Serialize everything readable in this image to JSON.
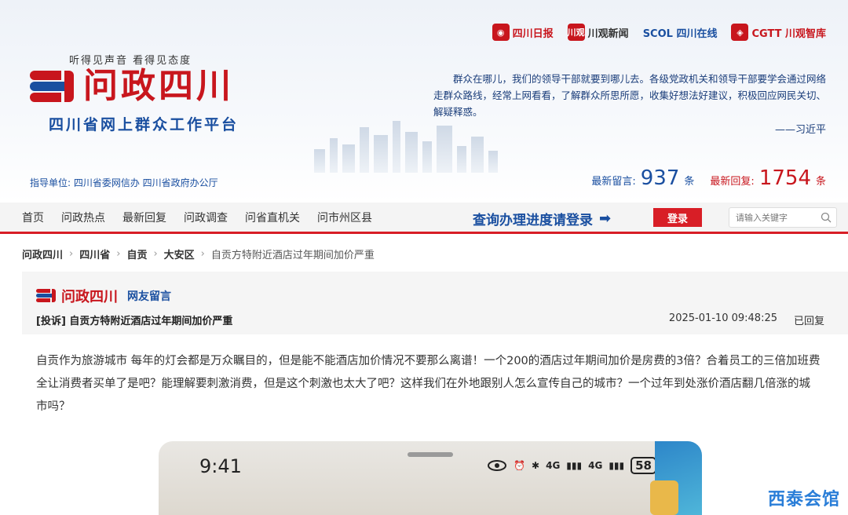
{
  "colors": {
    "brand_red": "#c8161d",
    "brand_blue": "#1a4fa0",
    "nav_red": "#d81e26"
  },
  "partners": [
    {
      "name": "四川日报",
      "icon": "sichuan-daily-logo"
    },
    {
      "name": "川观新闻",
      "mark": "川观",
      "icon": "chuanguan-logo"
    },
    {
      "name": "SCOL 四川在线",
      "icon": "scol-logo"
    },
    {
      "name": "CGTT 川观智库",
      "icon": "cgtt-logo"
    }
  ],
  "header": {
    "slogan": "听得见声音  看得见态度",
    "title": "问政四川",
    "subtitle": "四川省网上群众工作平台",
    "guidance": "指导单位: 四川省委网信办 四川省政府办公厅",
    "quote": "群众在哪儿，我们的领导干部就要到哪儿去。各级党政机关和领导干部要学会通过网络走群众路线，经常上网看看，了解群众所思所愿，收集好想法好建议，积极回应网民关切、解疑释惑。",
    "quote_author": "——习近平",
    "stats": {
      "latest_message_label": "最新留言:",
      "latest_message_count": "937",
      "latest_message_unit": "条",
      "latest_reply_label": "最新回复:",
      "latest_reply_count": "1754",
      "latest_reply_unit": "条"
    }
  },
  "nav": {
    "items": [
      "首页",
      "问政热点",
      "最新回复",
      "问政调查",
      "问省直机关",
      "问市州区县"
    ],
    "cta": "查询办理进度请登录",
    "login_label": "登录",
    "search_placeholder": "请输入关键字"
  },
  "breadcrumb": {
    "items": [
      "问政四川",
      "四川省",
      "自贡",
      "大安区"
    ],
    "current": "自贡方特附近酒店过年期间加价严重"
  },
  "post": {
    "logo_text": "问政四川",
    "type_label": "网友留言",
    "title": "[投诉] 自贡方特附近酒店过年期间加价严重",
    "date": "2025-01-10 09:48:25",
    "status": "已回复",
    "body": "自贡作为旅游城市 每年的灯会都是万众瞩目的，但是能不能酒店加价情况不要那么离谱！一个200的酒店过年期间加价是房费的3倍？合着员工的三倍加班费全让消费者买单了是吧？能理解要刺激消费，但是这个刺激也太大了吧？这样我们在外地跟别人怎么宣传自己的城市？一个过年到处涨价酒店翻几倍涨的城市吗？"
  },
  "phone": {
    "time": "9:41",
    "signal1": "4G",
    "signal2": "4G",
    "battery": "58"
  },
  "watermark": "西泰会馆"
}
